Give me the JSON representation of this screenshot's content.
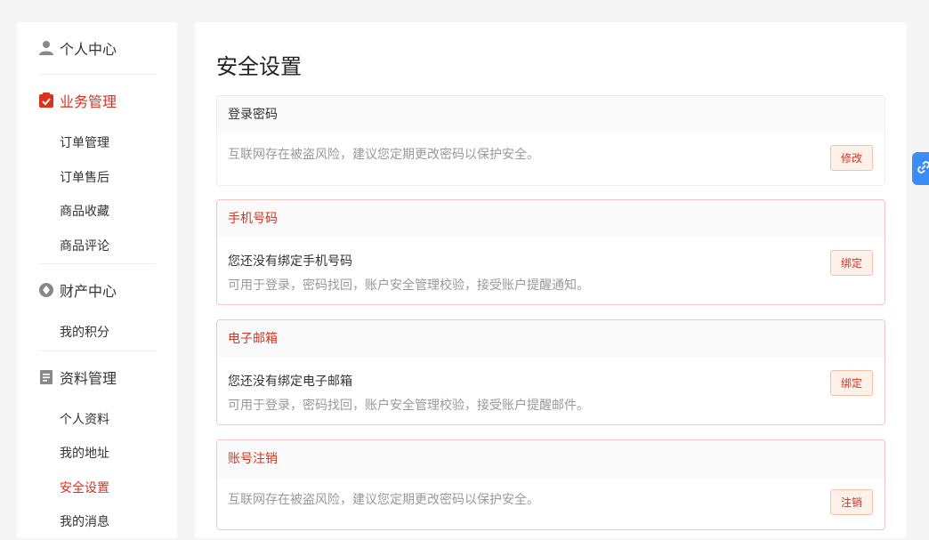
{
  "sidebar": {
    "groups": [
      {
        "title": "个人中心",
        "items": []
      },
      {
        "title": "业务管理",
        "items": [
          "订单管理",
          "订单售后",
          "商品收藏",
          "商品评论"
        ]
      },
      {
        "title": "财产中心",
        "items": [
          "我的积分"
        ]
      },
      {
        "title": "资料管理",
        "items": [
          "个人资料",
          "我的地址",
          "安全设置",
          "我的消息"
        ]
      }
    ],
    "active_item": "安全设置"
  },
  "main": {
    "title": "安全设置",
    "cards": [
      {
        "header": "登录密码",
        "main_text": "",
        "sub_text": "互联网存在被盗风险，建议您定期更改密码以保护安全。",
        "button": "修改"
      },
      {
        "header": "手机号码",
        "main_text": "您还没有绑定手机号码",
        "sub_text": "可用于登录，密码找回，账户安全管理校验，接受账户提醒通知。",
        "button": "绑定"
      },
      {
        "header": "电子邮箱",
        "main_text": "您还没有绑定电子邮箱",
        "sub_text": "可用于登录，密码找回，账户安全管理校验，接受账户提醒邮件。",
        "button": "绑定"
      },
      {
        "header": "账号注销",
        "main_text": "",
        "sub_text": "互联网存在被盗风险，建议您定期更改密码以保护安全。",
        "button": "注销"
      }
    ]
  },
  "colors": {
    "accent": "#d9321f",
    "button_bg": "#fdf1ea",
    "float_tab": "#3a8df5"
  }
}
